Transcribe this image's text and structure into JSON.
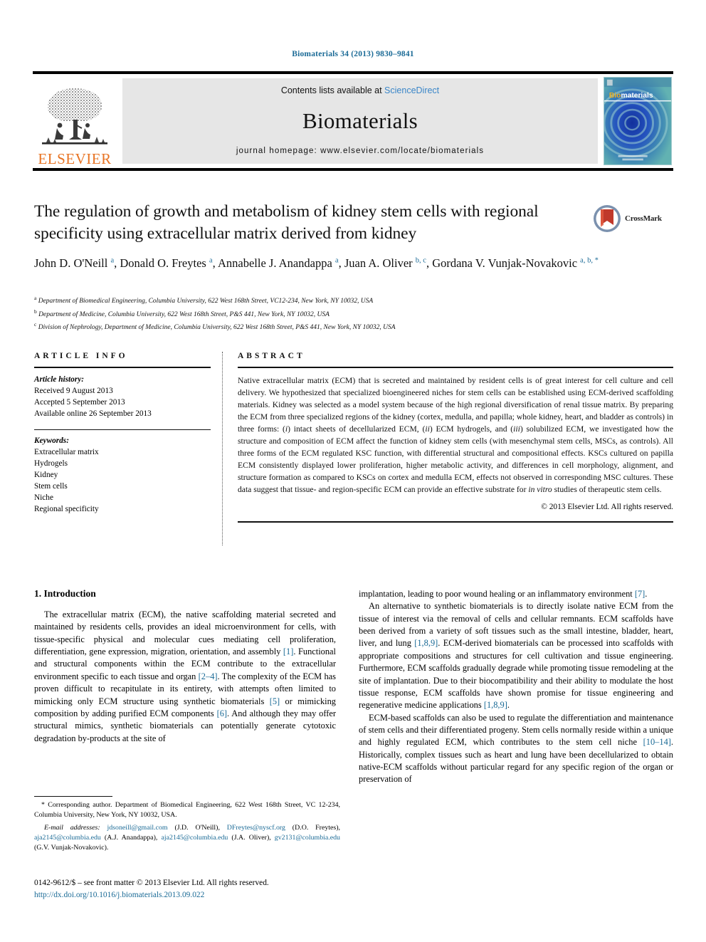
{
  "running_head": "Biomaterials 34 (2013) 9830–9841",
  "masthead": {
    "publisher": "ELSEVIER",
    "contents_prefix": "Contents lists available at ",
    "contents_link": "ScienceDirect",
    "journal_name": "Biomaterials",
    "homepage": "journal homepage: www.elsevier.com/locate/biomaterials",
    "cover_title_prefix": "Bio",
    "cover_title_rest": "materials"
  },
  "crossmark": {
    "label": "CrossMark"
  },
  "article": {
    "title": "The regulation of growth and metabolism of kidney stem cells with regional specificity using extracellular matrix derived from kidney",
    "authors_html": "John D. O'Neill <sup>a</sup>, Donald O. Freytes <sup>a</sup>, Annabelle J. Anandappa <sup>a</sup>, Juan A. Oliver <sup>b, c</sup>, Gordana V. Vunjak-Novakovic <sup>a, b, *</sup>",
    "affiliations": [
      {
        "marker": "a",
        "text": "Department of Biomedical Engineering, Columbia University, 622 West 168th Street, VC12-234, New York, NY 10032, USA"
      },
      {
        "marker": "b",
        "text": "Department of Medicine, Columbia University, 622 West 168th Street, P&S 441, New York, NY 10032, USA"
      },
      {
        "marker": "c",
        "text": "Division of Nephrology, Department of Medicine, Columbia University, 622 West 168th Street, P&S 441, New York, NY 10032, USA"
      }
    ]
  },
  "article_info": {
    "heading": "ARTICLE INFO",
    "history_label": "Article history:",
    "history": [
      "Received 9 August 2013",
      "Accepted 5 September 2013",
      "Available online 26 September 2013"
    ],
    "keywords_label": "Keywords:",
    "keywords": [
      "Extracellular matrix",
      "Hydrogels",
      "Kidney",
      "Stem cells",
      "Niche",
      "Regional specificity"
    ]
  },
  "abstract": {
    "heading": "ABSTRACT",
    "text": "Native extracellular matrix (ECM) that is secreted and maintained by resident cells is of great interest for cell culture and cell delivery. We hypothesized that specialized bioengineered niches for stem cells can be established using ECM-derived scaffolding materials. Kidney was selected as a model system because of the high regional diversification of renal tissue matrix. By preparing the ECM from three specialized regions of the kidney (cortex, medulla, and papilla; whole kidney, heart, and bladder as controls) in three forms: (i) intact sheets of decellularized ECM, (ii) ECM hydrogels, and (iii) solubilized ECM, we investigated how the structure and composition of ECM affect the function of kidney stem cells (with mesenchymal stem cells, MSCs, as controls). All three forms of the ECM regulated KSC function, with differential structural and compositional effects. KSCs cultured on papilla ECM consistently displayed lower proliferation, higher metabolic activity, and differences in cell morphology, alignment, and structure formation as compared to KSCs on cortex and medulla ECM, effects not observed in corresponding MSC cultures. These data suggest that tissue- and region-specific ECM can provide an effective substrate for in vitro studies of therapeutic stem cells.",
    "copyright": "© 2013 Elsevier Ltd. All rights reserved."
  },
  "body": {
    "section_title": "1. Introduction",
    "left_paragraphs": [
      "The extracellular matrix (ECM), the native scaffolding material secreted and maintained by residents cells, provides an ideal microenvironment for cells, with tissue-specific physical and molecular cues mediating cell proliferation, differentiation, gene expression, migration, orientation, and assembly [1]. Functional and structural components within the ECM contribute to the extracellular environment specific to each tissue and organ [2–4]. The complexity of the ECM has proven difficult to recapitulate in its entirety, with attempts often limited to mimicking only ECM structure using synthetic biomaterials [5] or mimicking composition by adding purified ECM components [6]. And although they may offer structural mimics, synthetic biomaterials can potentially generate cytotoxic degradation by-products at the site of"
    ],
    "right_paragraphs": [
      "implantation, leading to poor wound healing or an inflammatory environment [7].",
      "An alternative to synthetic biomaterials is to directly isolate native ECM from the tissue of interest via the removal of cells and cellular remnants. ECM scaffolds have been derived from a variety of soft tissues such as the small intestine, bladder, heart, liver, and lung [1,8,9]. ECM-derived biomaterials can be processed into scaffolds with appropriate compositions and structures for cell cultivation and tissue engineering. Furthermore, ECM scaffolds gradually degrade while promoting tissue remodeling at the site of implantation. Due to their biocompatibility and their ability to modulate the host tissue response, ECM scaffolds have shown promise for tissue engineering and regenerative medicine applications [1,8,9].",
      "ECM-based scaffolds can also be used to regulate the differentiation and maintenance of stem cells and their differentiated progeny. Stem cells normally reside within a unique and highly regulated ECM, which contributes to the stem cell niche [10–14]. Historically, complex tissues such as heart and lung have been decellularized to obtain native-ECM scaffolds without particular regard for any specific region of the organ or preservation of"
    ]
  },
  "footnotes": {
    "corresponding": "* Corresponding author. Department of Biomedical Engineering, 622 West 168th Street, VC 12-234, Columbia University, New York, NY 10032, USA.",
    "emails_label": "E-mail addresses:",
    "emails": [
      {
        "address": "jdsoneill@gmail.com",
        "owner": "(J.D. O'Neill)"
      },
      {
        "address": "DFreytes@nyscf.org",
        "owner": "(D.O. Freytes)"
      },
      {
        "address": "aja2145@columbia.edu",
        "owner": "(A.J. Anandappa)"
      },
      {
        "address": "aja2145@columbia.edu",
        "owner": "(J.A. Oliver)"
      },
      {
        "address": "gv2131@columbia.edu",
        "owner": "(G.V. Vunjak-Novakovic)"
      }
    ],
    "issn_line": "0142-9612/$ – see front matter © 2013 Elsevier Ltd. All rights reserved.",
    "doi": "http://dx.doi.org/10.1016/j.biomaterials.2013.09.022"
  },
  "colors": {
    "link": "#1a6a96",
    "elsevier_orange": "#e87424",
    "sciencedirect_blue": "#3a86c8",
    "cover_teal": "#54a7ad",
    "cover_blue": "#1f3fa8"
  }
}
